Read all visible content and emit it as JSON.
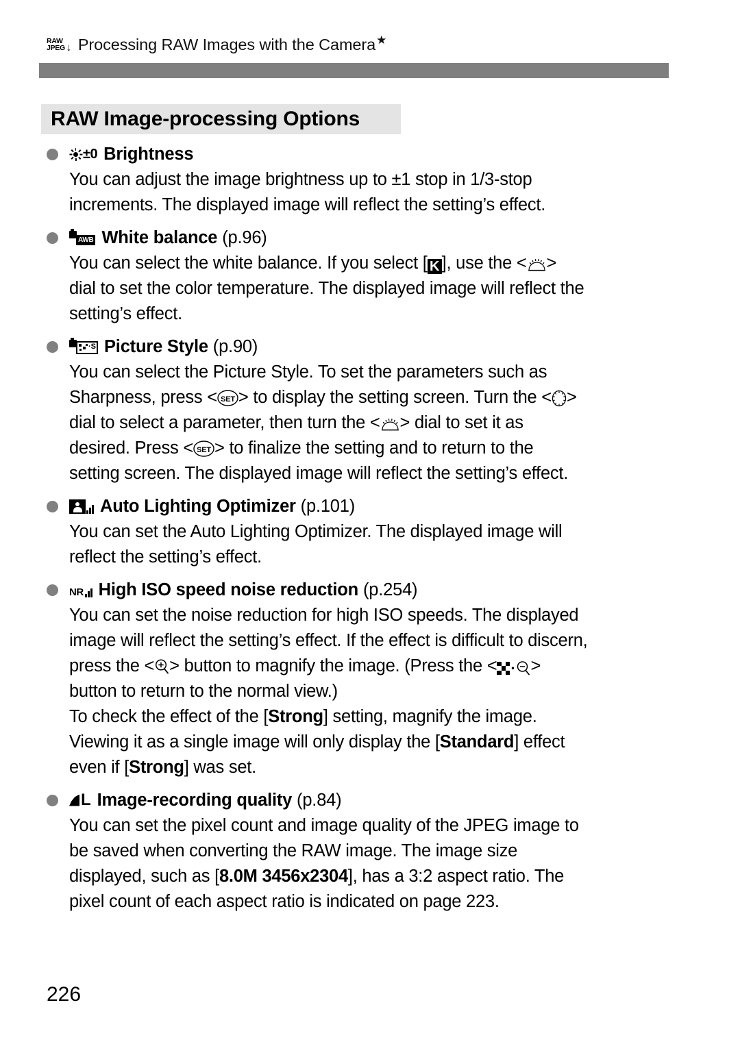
{
  "header": {
    "icon": "raw-to-jpeg-icon",
    "icon_top": "RAW",
    "icon_bottom": "JPEG",
    "icon_arrow": "↓",
    "title": "Processing RAW Images with the Camera",
    "star": "★"
  },
  "section": {
    "title": "RAW Image-processing Options",
    "background_color": "#e4e4e4",
    "bar_color": "#7f7f7f"
  },
  "items": [
    {
      "icon": "brightness-sun-icon",
      "icon_label": "±0",
      "title": "Brightness",
      "page_ref": "",
      "body": [
        "You can adjust the image brightness up to ±1 stop in 1/3-stop",
        "increments. The displayed image will reflect the setting’s effect."
      ]
    },
    {
      "icon": "camera-awb-icon",
      "icon_label": "AWB",
      "title": "White balance",
      "page_ref": "(p.96)",
      "body_parts": {
        "l1a": "You can select the white balance. If you select [",
        "k_icon": "K",
        "l1b": "], use the <",
        "dial_icon": "main-dial-icon",
        "l1c": ">",
        "l2": "dial to set the color temperature. The displayed image will reflect the",
        "l3": "setting’s effect."
      }
    },
    {
      "icon": "camera-picture-style-icon",
      "icon_label": "·S",
      "title": "Picture Style",
      "page_ref": "(p.90)",
      "body_parts": {
        "l1": "You can select the Picture Style. To set the parameters such as",
        "l2a": "Sharpness, press <",
        "set_icon": "set-button-icon",
        "l2b": "> to display the setting screen. Turn the <",
        "quick_icon": "quick-control-dial-icon",
        "l2c": ">",
        "l3a": "dial to select a parameter, then turn the <",
        "main_icon": "main-dial-icon",
        "l3b": "> dial to set it as",
        "l4a": "desired. Press <",
        "set_icon2": "set-button-icon",
        "l4b": "> to finalize the setting and to return to the",
        "l5": "setting screen. The displayed image will reflect the setting’s effect."
      }
    },
    {
      "icon": "auto-lighting-optimizer-icon",
      "title": "Auto Lighting Optimizer",
      "page_ref": "(p.101)",
      "body": [
        "You can set the Auto Lighting Optimizer. The displayed image will",
        "reflect the setting’s effect."
      ]
    },
    {
      "icon": "noise-reduction-icon",
      "icon_label": "NR",
      "title": "High ISO speed noise reduction",
      "page_ref": "(p.254)",
      "body_parts": {
        "l1": "You can set the noise reduction for high ISO speeds. The displayed",
        "l2": "image will reflect the setting’s effect. If the effect is difficult to discern,",
        "l3a": "press the <",
        "mag_icon": "magnify-button-icon",
        "l3b": "> button to magnify the image. (Press the <",
        "index_icon": "index-reduce-button-icon",
        "l3c": ">",
        "l4": "button to return to the normal view.)",
        "l5a": "To check the effect of the [",
        "l5b": "Strong",
        "l5c": "] setting, magnify the image.",
        "l6a": "Viewing it as a single image will only display the [",
        "l6b": "Standard",
        "l6c": "] effect",
        "l7a": "even if [",
        "l7b": "Strong",
        "l7c": "] was set."
      }
    },
    {
      "icon": "image-quality-large-fine-icon",
      "icon_label": "L",
      "title": "Image-recording quality",
      "page_ref": "(p.84)",
      "body_parts": {
        "l1": "You can set the pixel count and image quality of the JPEG image to",
        "l2": "be saved when converting the RAW image. The image size",
        "l3a": "displayed, such as [",
        "l3b": "8.0M 3456x2304",
        "l3c": "], has a 3:2 aspect ratio. The",
        "l4": "pixel count of each aspect ratio is indicated on page 223."
      }
    }
  ],
  "page_number": "226"
}
